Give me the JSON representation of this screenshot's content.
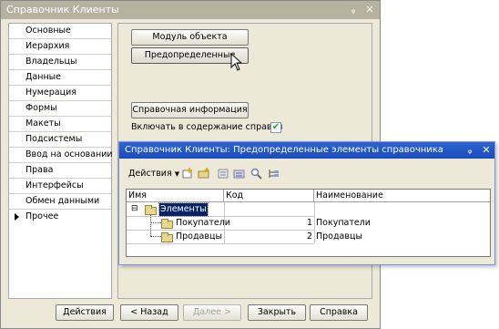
{
  "main_window": {
    "title": "Справочник Клиенты",
    "pin_glyph": "ᵩ",
    "close_glyph": "✕"
  },
  "sidebar": {
    "items": [
      {
        "label": "Основные"
      },
      {
        "label": "Иерархия"
      },
      {
        "label": "Владельцы"
      },
      {
        "label": "Данные"
      },
      {
        "label": "Нумерация"
      },
      {
        "label": "Формы"
      },
      {
        "label": "Макеты"
      },
      {
        "label": "Подсистемы"
      },
      {
        "label": "Ввод на основании"
      },
      {
        "label": "Права"
      },
      {
        "label": "Интерфейсы"
      },
      {
        "label": "Обмен данными"
      },
      {
        "label": "Прочее"
      }
    ],
    "active_index": 12
  },
  "panel": {
    "module_button": "Модуль объекта",
    "predefined_button": "Предопределенные",
    "help_button": "Справочная информация",
    "include_help_label": "Включать в содержание справки",
    "include_help_checked": true
  },
  "bottom_bar": {
    "actions": "Действия",
    "back": "< Назад",
    "next": "Далее >",
    "close": "Закрыть",
    "help": "Справка"
  },
  "sub_window": {
    "title": "Справочник Клиенты: Предопределенные элементы справочника",
    "pin_glyph": "ᵩ",
    "close_glyph": "✕",
    "toolbar": {
      "actions_label": "Действия",
      "icons": [
        "add-icon",
        "add-folder-icon",
        "edit-icon",
        "move-to-group-icon",
        "find-icon",
        "hierarchy-icon"
      ]
    },
    "grid": {
      "columns": [
        "Имя",
        "Код",
        "Наименование"
      ],
      "root": {
        "name": "Элементы",
        "expander": "⊟"
      },
      "rows": [
        {
          "name": "Покупатели",
          "code": "1",
          "description": "Покупатели"
        },
        {
          "name": "Продавцы",
          "code": "2",
          "description": "Продавцы"
        }
      ]
    }
  },
  "colors": {
    "main_title_bg": "#b7b29f",
    "sub_title_bg": "#1a4bbd",
    "selection_bg": "#0a246a",
    "window_bg": "#ece9d8"
  }
}
